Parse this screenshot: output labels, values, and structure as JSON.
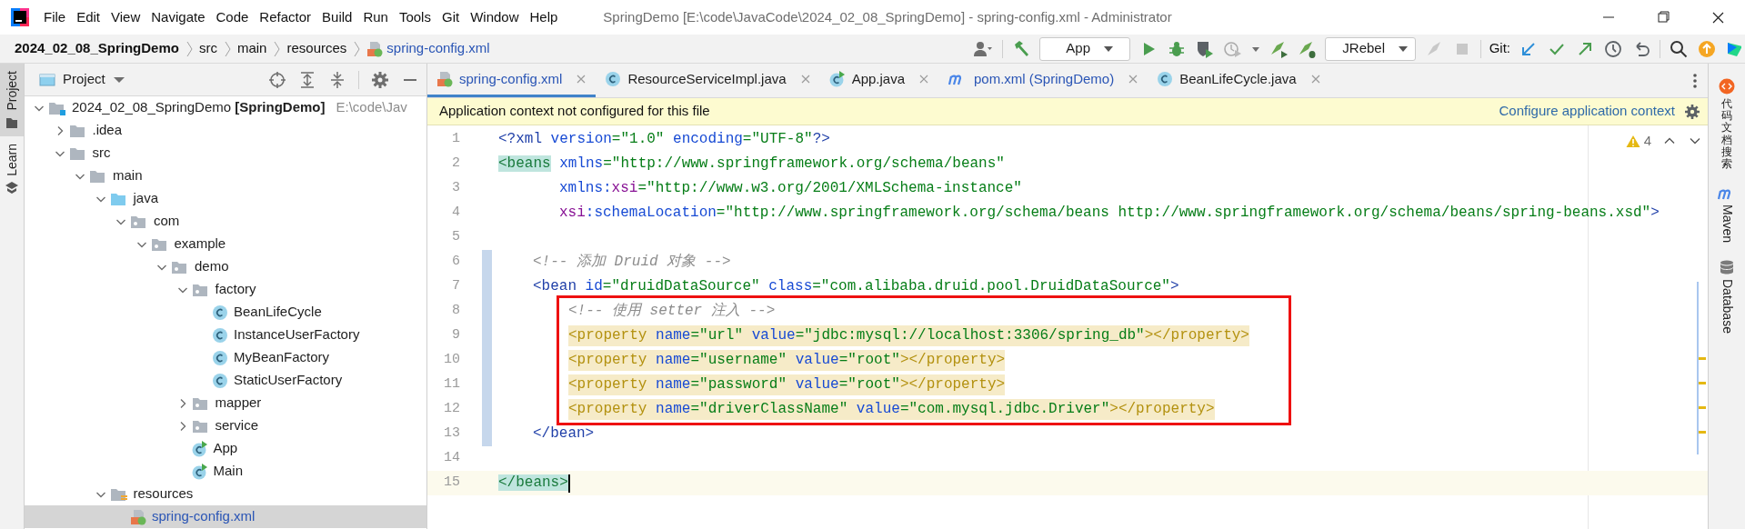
{
  "title_bar": {
    "menu": [
      "File",
      "Edit",
      "View",
      "Navigate",
      "Code",
      "Refactor",
      "Build",
      "Run",
      "Tools",
      "Git",
      "Window",
      "Help"
    ],
    "title": "SpringDemo [E:\\code\\JavaCode\\2024_02_08_SpringDemo] - spring-config.xml - Administrator"
  },
  "navigation_bar": {
    "breadcrumbs": [
      {
        "label": "2024_02_08_SpringDemo",
        "kind": "module",
        "modified": false
      },
      {
        "label": "src",
        "kind": "folder",
        "modified": false
      },
      {
        "label": "main",
        "kind": "folder",
        "modified": false
      },
      {
        "label": "resources",
        "kind": "folder",
        "modified": false
      },
      {
        "label": "spring-config.xml",
        "kind": "xml",
        "modified": true
      }
    ],
    "run_configuration": "App",
    "jrebel_configuration": "JRebel",
    "git_label": "Git:"
  },
  "left_stripe": [
    {
      "label": "Project",
      "selected": true
    },
    {
      "label": "Learn",
      "selected": false
    }
  ],
  "project_panel": {
    "title": "Project",
    "tree": [
      {
        "label": "2024_02_08_SpringDemo **[SpringDemo]**",
        "location": "E:\\code\\Jav",
        "kind": "module",
        "expanded": true,
        "selected": false,
        "modified": false,
        "children": [
          {
            "label": ".idea",
            "kind": "folder",
            "expanded": false,
            "selected": false,
            "modified": false
          },
          {
            "label": "src",
            "kind": "folder",
            "expanded": true,
            "selected": false,
            "modified": false,
            "children": [
              {
                "label": "main",
                "kind": "folder",
                "expanded": true,
                "selected": false,
                "modified": false,
                "children": [
                  {
                    "label": "java",
                    "kind": "source",
                    "expanded": true,
                    "selected": false,
                    "modified": false,
                    "children": [
                      {
                        "label": "com",
                        "kind": "package",
                        "expanded": true,
                        "selected": false,
                        "modified": false,
                        "children": [
                          {
                            "label": "example",
                            "kind": "package",
                            "expanded": true,
                            "selected": false,
                            "modified": false,
                            "children": [
                              {
                                "label": "demo",
                                "kind": "package",
                                "expanded": true,
                                "selected": false,
                                "modified": false,
                                "children": [
                                  {
                                    "label": "factory",
                                    "kind": "package",
                                    "expanded": true,
                                    "selected": false,
                                    "modified": false,
                                    "children": [
                                      {
                                        "label": "BeanLifeCycle",
                                        "kind": "class",
                                        "selected": false,
                                        "modified": false
                                      },
                                      {
                                        "label": "InstanceUserFactory",
                                        "kind": "class",
                                        "selected": false,
                                        "modified": false
                                      },
                                      {
                                        "label": "MyBeanFactory",
                                        "kind": "class",
                                        "selected": false,
                                        "modified": false
                                      },
                                      {
                                        "label": "StaticUserFactory",
                                        "kind": "class",
                                        "selected": false,
                                        "modified": false
                                      }
                                    ]
                                  },
                                  {
                                    "label": "mapper",
                                    "kind": "package",
                                    "expanded": false,
                                    "selected": false,
                                    "modified": false
                                  },
                                  {
                                    "label": "service",
                                    "kind": "package",
                                    "expanded": false,
                                    "selected": false,
                                    "modified": false
                                  },
                                  {
                                    "label": "App",
                                    "kind": "runnable",
                                    "selected": false,
                                    "modified": false
                                  },
                                  {
                                    "label": "Main",
                                    "kind": "runnable",
                                    "selected": false,
                                    "modified": false
                                  }
                                ]
                              }
                            ]
                          }
                        ]
                      }
                    ]
                  },
                  {
                    "label": "resources",
                    "kind": "resources",
                    "expanded": true,
                    "selected": false,
                    "modified": false,
                    "children": [
                      {
                        "label": "spring-config.xml",
                        "kind": "xml",
                        "selected": true,
                        "modified": true
                      }
                    ]
                  }
                ]
              }
            ]
          }
        ]
      }
    ]
  },
  "editor": {
    "tabs": [
      {
        "label": "spring-config.xml",
        "kind": "xml",
        "selected": true,
        "modified": true
      },
      {
        "label": "ResourceServiceImpl.java",
        "kind": "class",
        "selected": false,
        "modified": false
      },
      {
        "label": "App.java",
        "kind": "runnable",
        "selected": false,
        "modified": false
      },
      {
        "label": "pom.xml (SpringDemo)",
        "kind": "maven",
        "selected": false,
        "modified": true
      },
      {
        "label": "BeanLifeCycle.java",
        "kind": "class",
        "selected": false,
        "modified": false
      }
    ],
    "notification": {
      "message": "Application context not configured for this file",
      "link": "Configure application context"
    },
    "warnings": "4",
    "lines": [
      {
        "number": "1",
        "kind": "prolog",
        "modified": false,
        "warning": false,
        "boxed": false,
        "current": false,
        "tokens": [
          {
            "kind": "tag",
            "text": "<?xml"
          },
          {
            "kind": "attr",
            "text": " version"
          },
          {
            "kind": "value",
            "text": "=\"1.0\""
          },
          {
            "kind": "attr",
            "text": " encoding"
          },
          {
            "kind": "value",
            "text": "=\"UTF-8\""
          },
          {
            "kind": "tag",
            "text": "?>"
          }
        ]
      },
      {
        "number": "2",
        "kind": "root",
        "modified": false,
        "warning": false,
        "boxed": false,
        "current": false,
        "tokens": [
          {
            "kind": "match",
            "text": "<beans"
          },
          {
            "kind": "attr",
            "text": " xmlns"
          },
          {
            "kind": "value",
            "text": "=\"http://www.springframework.org/schema/beans\""
          }
        ]
      },
      {
        "number": "3",
        "kind": "root-attribute",
        "modified": false,
        "warning": false,
        "boxed": false,
        "current": false,
        "tokens": [
          {
            "kind": "attr",
            "text": "xmlns:"
          },
          {
            "kind": "ns",
            "text": "xsi"
          },
          {
            "kind": "value",
            "text": "=\"http://www.w3.org/2001/XMLSchema-instance\""
          }
        ]
      },
      {
        "number": "4",
        "kind": "root-attribute",
        "modified": false,
        "warning": false,
        "boxed": false,
        "current": false,
        "tokens": [
          {
            "kind": "ns",
            "text": "xsi"
          },
          {
            "kind": "attr",
            "text": ":schemaLocation"
          },
          {
            "kind": "value",
            "text": "=\"http://www.springframework.org/schema/beans http://www.springframework.org/schema/beans/spring-beans.xsd\""
          },
          {
            "kind": "tag",
            "text": ">"
          }
        ]
      },
      {
        "number": "5",
        "kind": "blank",
        "modified": false,
        "warning": false,
        "boxed": false,
        "current": false
      },
      {
        "number": "6",
        "kind": "bean",
        "modified": true,
        "warning": false,
        "boxed": false,
        "current": false,
        "tokens": [
          {
            "kind": "comment",
            "text": "<!-- 添加 Druid 对象 -->"
          }
        ]
      },
      {
        "number": "7",
        "kind": "bean",
        "modified": true,
        "warning": false,
        "boxed": false,
        "current": false,
        "tokens": [
          {
            "kind": "tag",
            "text": "<bean"
          },
          {
            "kind": "attr",
            "text": " id"
          },
          {
            "kind": "value",
            "text": "=\"druidDataSource\""
          },
          {
            "kind": "attr",
            "text": " class"
          },
          {
            "kind": "value",
            "text": "=\"com.alibaba.druid.pool.DruidDataSource\""
          },
          {
            "kind": "tag",
            "text": ">"
          }
        ]
      },
      {
        "number": "8",
        "kind": "property",
        "modified": true,
        "warning": false,
        "boxed": true,
        "current": false,
        "tokens": [
          {
            "kind": "comment",
            "text": "<!-- 使用 setter 注入 -->"
          }
        ]
      },
      {
        "number": "9",
        "kind": "property",
        "modified": true,
        "warning": true,
        "boxed": true,
        "current": false,
        "tokens": [
          {
            "kind": "warn",
            "text": "<property"
          },
          {
            "kind": "attr",
            "text": " name"
          },
          {
            "kind": "value",
            "text": "=\"url\""
          },
          {
            "kind": "attr",
            "text": " value"
          },
          {
            "kind": "value",
            "text": "=\"jdbc:mysql://localhost:3306/spring_db\""
          },
          {
            "kind": "warn",
            "text": "></property>"
          }
        ]
      },
      {
        "number": "10",
        "kind": "property",
        "modified": true,
        "warning": true,
        "boxed": true,
        "current": false,
        "tokens": [
          {
            "kind": "warn",
            "text": "<property"
          },
          {
            "kind": "attr",
            "text": " name"
          },
          {
            "kind": "value",
            "text": "=\"username\""
          },
          {
            "kind": "attr",
            "text": " value"
          },
          {
            "kind": "value",
            "text": "=\"root\""
          },
          {
            "kind": "warn",
            "text": "></property>"
          }
        ]
      },
      {
        "number": "11",
        "kind": "property",
        "modified": true,
        "warning": true,
        "boxed": true,
        "current": false,
        "tokens": [
          {
            "kind": "warn",
            "text": "<property"
          },
          {
            "kind": "attr",
            "text": " name"
          },
          {
            "kind": "value",
            "text": "=\"password\""
          },
          {
            "kind": "attr",
            "text": " value"
          },
          {
            "kind": "value",
            "text": "=\"root\""
          },
          {
            "kind": "warn",
            "text": "></property>"
          }
        ]
      },
      {
        "number": "12",
        "kind": "property",
        "modified": true,
        "warning": true,
        "boxed": true,
        "current": false,
        "tokens": [
          {
            "kind": "warn",
            "text": "<property"
          },
          {
            "kind": "attr",
            "text": " name"
          },
          {
            "kind": "value",
            "text": "=\"driverClassName\""
          },
          {
            "kind": "attr",
            "text": " value"
          },
          {
            "kind": "value",
            "text": "=\"com.mysql.jdbc.Driver\""
          },
          {
            "kind": "warn",
            "text": "></property>"
          }
        ]
      },
      {
        "number": "13",
        "kind": "bean",
        "modified": true,
        "warning": false,
        "boxed": false,
        "current": false,
        "tokens": [
          {
            "kind": "tag",
            "text": "</bean>"
          }
        ]
      },
      {
        "number": "14",
        "kind": "blank",
        "modified": false,
        "warning": false,
        "boxed": false,
        "current": false
      },
      {
        "number": "15",
        "kind": "root",
        "modified": false,
        "warning": false,
        "boxed": false,
        "current": true,
        "tokens": [
          {
            "kind": "match",
            "text": "</beans>"
          }
        ]
      }
    ]
  },
  "right_stripe": [
    {
      "label": "代码文档搜索",
      "kind": "plugin"
    },
    {
      "label": "Maven",
      "kind": "maven"
    },
    {
      "label": "Database",
      "kind": "database"
    }
  ]
}
